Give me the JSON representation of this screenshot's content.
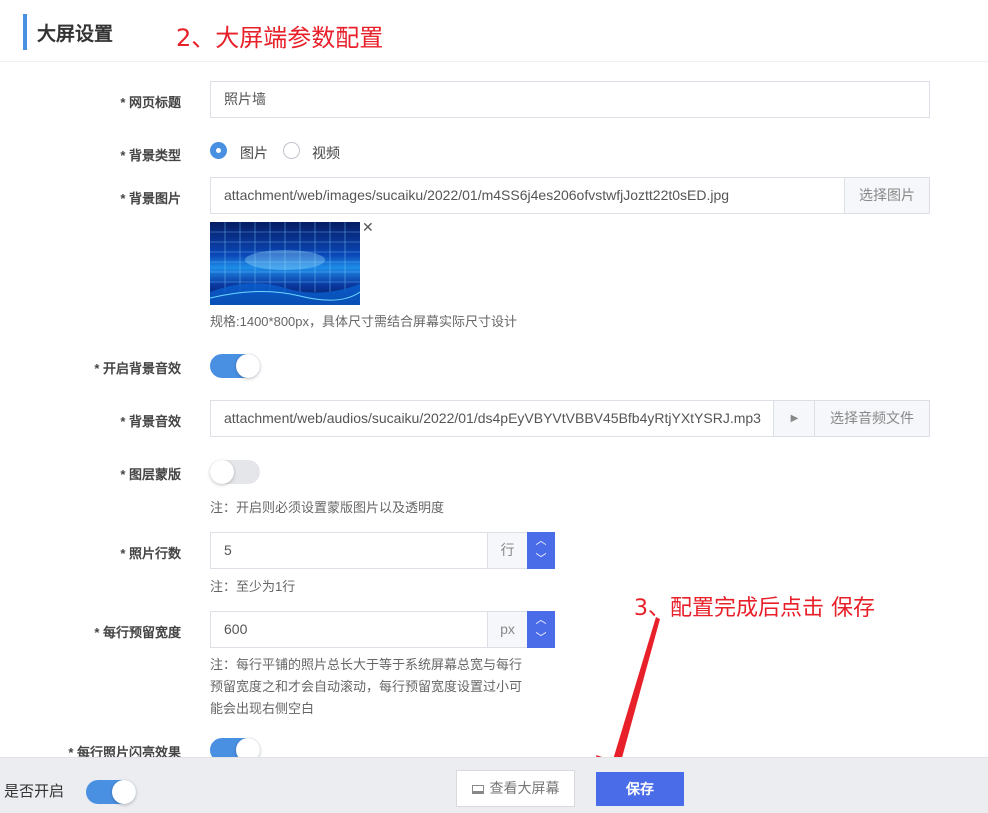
{
  "header": {
    "title": "大屏设置"
  },
  "annotations": {
    "step2": "2、大屏端参数配置",
    "step3": "3、配置完成后点击 保存"
  },
  "form": {
    "page_title": {
      "label": "* 网页标题",
      "value": "照片墙"
    },
    "bg_type": {
      "label": "* 背景类型",
      "options": [
        "图片",
        "视频"
      ],
      "selected": "图片"
    },
    "bg_image": {
      "label": "* 背景图片",
      "value": "attachment/web/images/sucaiku/2022/01/m4SS6j4es206ofvstwfjJoztt22t0sED.jpg",
      "button": "选择图片",
      "hint": "规格:1400*800px，具体尺寸需结合屏幕实际尺寸设计"
    },
    "bg_sound_enable": {
      "label": "* 开启背景音效",
      "on": true
    },
    "bg_sound": {
      "label": "* 背景音效",
      "value": "attachment/web/audios/sucaiku/2022/01/ds4pEyVBYVtVBBV45Bfb4yRtjYXtYSRJ.mp3",
      "play": "▶",
      "button": "选择音频文件"
    },
    "mask": {
      "label": "* 图层蒙版",
      "on": false,
      "hint": "注：开启则必须设置蒙版图片以及透明度"
    },
    "rows": {
      "label": "* 照片行数",
      "value": "5",
      "unit": "行",
      "hint": "注：至少为1行"
    },
    "reserve_width": {
      "label": "* 每行预留宽度",
      "value": "600",
      "unit": "px",
      "hint_lines": [
        "注：每行平铺的照片总长大于等于系统屏幕总宽与每行",
        "预留宽度之和才会自动滚动，每行预留宽度设置过小可",
        "能会出现右侧空白"
      ]
    },
    "flash": {
      "label": "* 每行照片闪亮效果",
      "on": true
    }
  },
  "footer": {
    "enable_label": "是否开启",
    "enable_on": true,
    "view_label": "查看大屏幕",
    "save_label": "保存"
  },
  "colors": {
    "accent": "#4a90e2",
    "button": "#4a6ce8",
    "annotation": "#e8202a"
  }
}
